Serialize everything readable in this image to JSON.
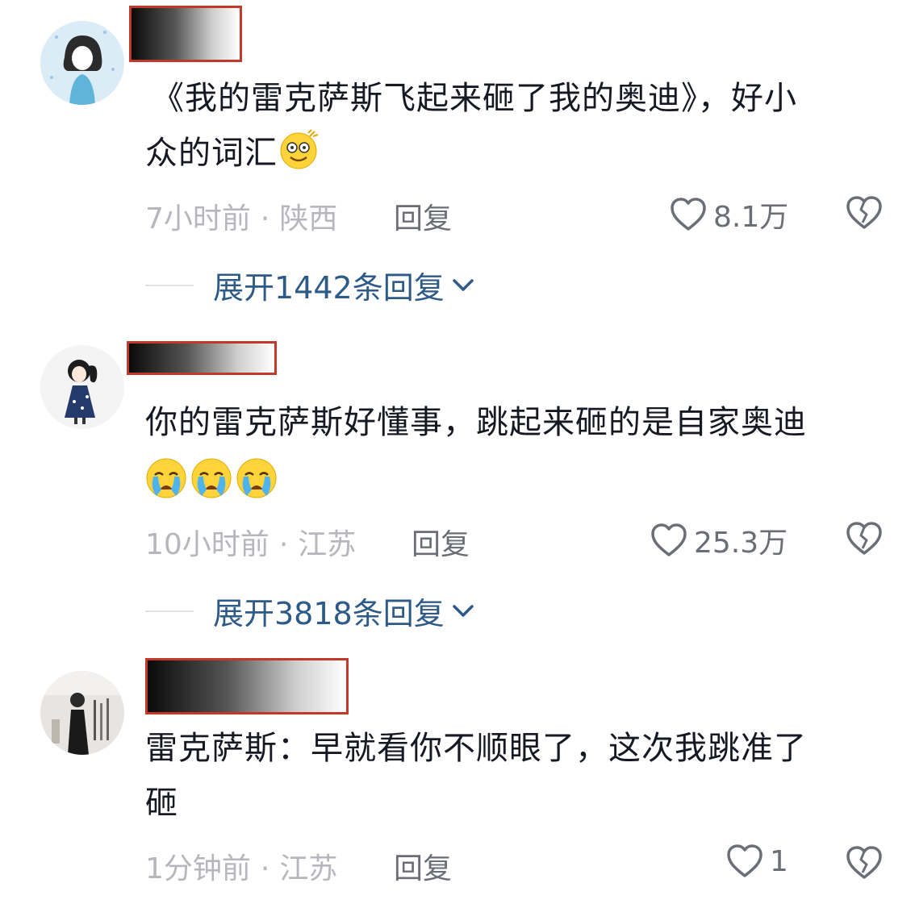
{
  "comments": [
    {
      "text_line1": "《我的雷克萨斯飞起来砸了我的奥迪》，好小",
      "text_line2": "众的词汇",
      "emoji": "dizzy-smile-emoji",
      "time": "7小时前",
      "location": "陕西",
      "reply_label": "回复",
      "likes": "8.1万",
      "expand_label": "展开1442条回复"
    },
    {
      "text_line1": "你的雷克萨斯好懂事，跳起来砸的是自家奥迪",
      "emoji": "crying-face-emoji",
      "time": "10小时前",
      "location": "江苏",
      "reply_label": "回复",
      "likes": "25.3万",
      "expand_label": "展开3818条回复"
    },
    {
      "text_line1": "雷克萨斯：早就看你不顺眼了，这次我跳准了",
      "text_line2": "砸",
      "time": "1分钟前",
      "location": "江苏",
      "reply_label": "回复",
      "likes": "1"
    }
  ],
  "meta_separator": "·",
  "colors": {
    "text": "#161823",
    "meta": "#b5b7bd",
    "action": "#6b6e76",
    "expand": "#2e5a87",
    "redaction_border": "#c0392b"
  }
}
